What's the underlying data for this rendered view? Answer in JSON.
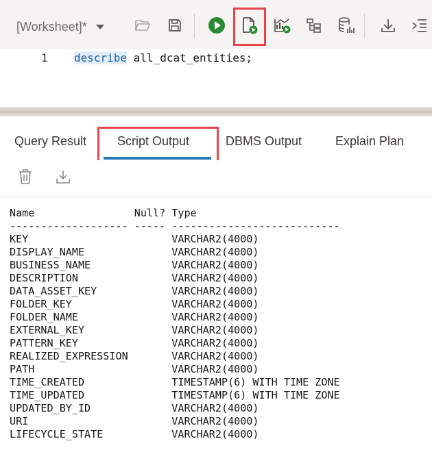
{
  "toolbar": {
    "worksheet_label": "[Worksheet]*",
    "icons": [
      "folder-open-icon",
      "save-icon",
      "run-statement-icon",
      "run-script-icon",
      "autotrace-icon",
      "explain-plan-icon",
      "sql-tuning-icon",
      "download-icon",
      "format-icon"
    ],
    "run_color": "#2a8a34",
    "highlight_color": "#e8434a"
  },
  "editor": {
    "line_number": "1",
    "keyword": "describe",
    "rest": " all_dcat_entities;"
  },
  "tabs": [
    {
      "label": "Query Result",
      "active": false
    },
    {
      "label": "Script Output",
      "active": true
    },
    {
      "label": "DBMS Output",
      "active": false
    },
    {
      "label": "Explain Plan",
      "active": false
    }
  ],
  "output_toolbar": {
    "icons": [
      "trash-icon",
      "download-icon"
    ]
  },
  "output": {
    "header": "Name                Null? Type",
    "separator": "------------------- ----- ---------------------------",
    "rows": [
      {
        "name": "KEY",
        "null": "",
        "type": "VARCHAR2(4000)"
      },
      {
        "name": "DISPLAY_NAME",
        "null": "",
        "type": "VARCHAR2(4000)"
      },
      {
        "name": "BUSINESS_NAME",
        "null": "",
        "type": "VARCHAR2(4000)"
      },
      {
        "name": "DESCRIPTION",
        "null": "",
        "type": "VARCHAR2(4000)"
      },
      {
        "name": "DATA_ASSET_KEY",
        "null": "",
        "type": "VARCHAR2(4000)"
      },
      {
        "name": "FOLDER_KEY",
        "null": "",
        "type": "VARCHAR2(4000)"
      },
      {
        "name": "FOLDER_NAME",
        "null": "",
        "type": "VARCHAR2(4000)"
      },
      {
        "name": "EXTERNAL_KEY",
        "null": "",
        "type": "VARCHAR2(4000)"
      },
      {
        "name": "PATTERN_KEY",
        "null": "",
        "type": "VARCHAR2(4000)"
      },
      {
        "name": "REALIZED_EXPRESSION",
        "null": "",
        "type": "VARCHAR2(4000)"
      },
      {
        "name": "PATH",
        "null": "",
        "type": "VARCHAR2(4000)"
      },
      {
        "name": "TIME_CREATED",
        "null": "",
        "type": "TIMESTAMP(6) WITH TIME ZONE"
      },
      {
        "name": "TIME_UPDATED",
        "null": "",
        "type": "TIMESTAMP(6) WITH TIME ZONE"
      },
      {
        "name": "UPDATED_BY_ID",
        "null": "",
        "type": "VARCHAR2(4000)"
      },
      {
        "name": "URI",
        "null": "",
        "type": "VARCHAR2(4000)"
      },
      {
        "name": "LIFECYCLE_STATE",
        "null": "",
        "type": "VARCHAR2(4000)"
      }
    ]
  }
}
